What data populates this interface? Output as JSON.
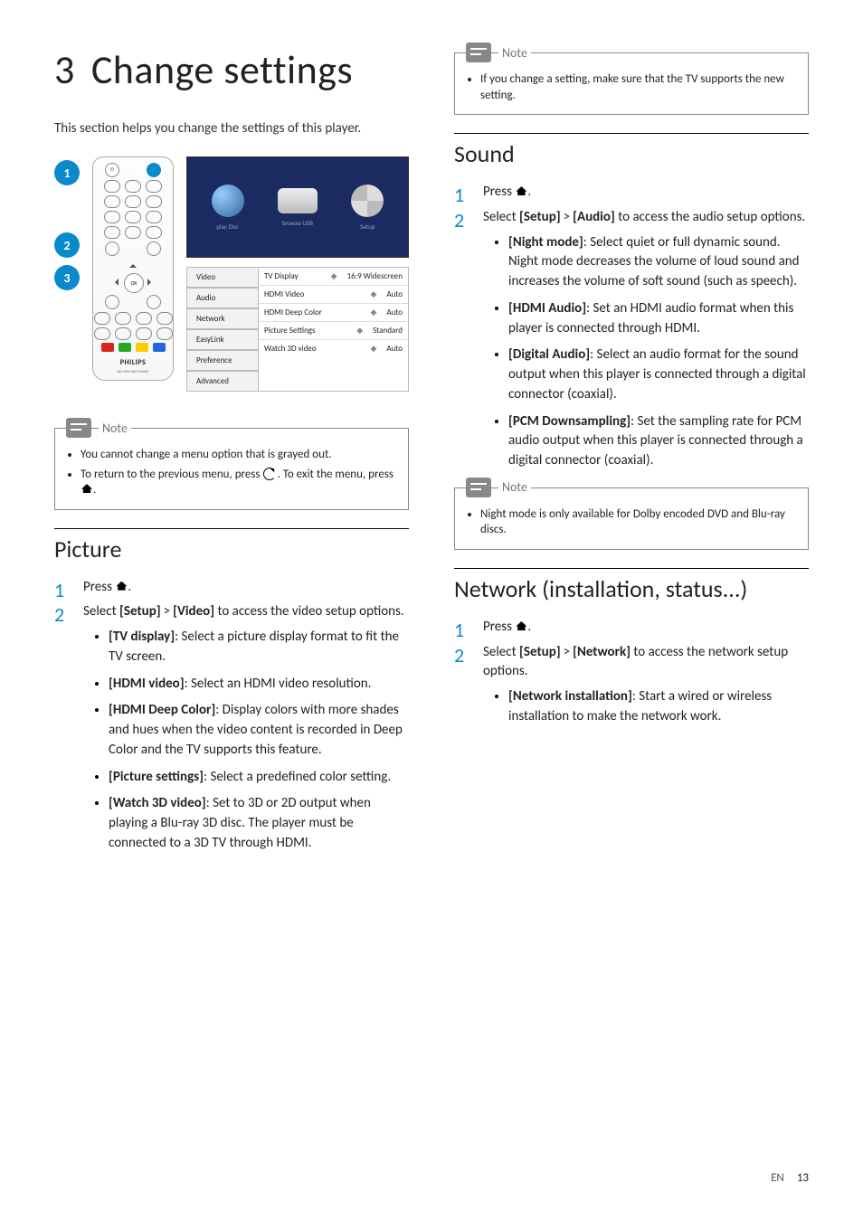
{
  "chapter": {
    "number": "3",
    "title": "Change settings"
  },
  "intro": "This section helps you change the settings of this player.",
  "illustration": {
    "badges": [
      "1",
      "2",
      "3"
    ],
    "remote": {
      "brand": "PHILIPS",
      "sub": "BLU-RAY DISC PLAYER",
      "ok": "OK"
    },
    "home_screen": [
      {
        "label": "play Disc"
      },
      {
        "label": "browse USB"
      },
      {
        "label": "Setup"
      }
    ],
    "sidebar": [
      "Video",
      "Audio",
      "Network",
      "EasyLink",
      "Preference",
      "Advanced"
    ],
    "options": [
      {
        "k": "TV Display",
        "v": "16:9 Widescreen"
      },
      {
        "k": "HDMI Video",
        "v": "Auto"
      },
      {
        "k": "HDMI Deep Color",
        "v": "Auto"
      },
      {
        "k": "Picture Settings",
        "v": "Standard"
      },
      {
        "k": "Watch 3D video",
        "v": "Auto"
      }
    ]
  },
  "note1": {
    "label": "Note",
    "items": [
      "You cannot change a menu option that is grayed out.",
      {
        "pre": "To return to the previous menu, press ",
        "mid": ". To exit the menu, press ",
        "post": "."
      }
    ]
  },
  "note_top_right": {
    "label": "Note",
    "items": [
      "If you change a setting, make sure that the TV supports the new setting."
    ]
  },
  "note_sound": {
    "label": "Note",
    "items": [
      "Night mode is only available for Dolby encoded DVD and Blu-ray discs."
    ]
  },
  "picture": {
    "heading": "Picture",
    "step1": "Press ",
    "step1_post": ".",
    "step2_pre": "Select ",
    "step2_a": "[Setup]",
    "step2_gt": ">",
    "step2_b": "[Video]",
    "step2_post": " to access the video setup options.",
    "bullets": [
      {
        "b": "[TV display]",
        "t": ": Select a picture display format to fit the TV screen."
      },
      {
        "b": "[HDMI video]",
        "t": ": Select an HDMI video resolution."
      },
      {
        "b": "[HDMI Deep Color]",
        "t": ": Display colors with more shades and hues when the video content is recorded in Deep Color and the TV supports this feature."
      },
      {
        "b": "[Picture settings]",
        "t": ": Select a predefined color setting."
      },
      {
        "b": "[Watch 3D video]",
        "t": ": Set to 3D or 2D output when playing a Blu-ray 3D disc. The player must be connected to a 3D TV through HDMI."
      }
    ]
  },
  "sound": {
    "heading": "Sound",
    "step1": "Press ",
    "step1_post": ".",
    "step2_pre": "Select ",
    "step2_a": "[Setup]",
    "step2_gt": ">",
    "step2_b": "[Audio]",
    "step2_post": " to access the audio setup options.",
    "bullets": [
      {
        "b": "[Night mode]",
        "t": ": Select quiet or full dynamic sound. Night mode decreases the volume of loud sound and increases the volume of soft sound (such as speech)."
      },
      {
        "b": "[HDMI Audio]",
        "t": ": Set an HDMI audio format when this player is connected through HDMI."
      },
      {
        "b": "[Digital Audio]",
        "t": ": Select an audio format for the sound output when this player is connected through a digital connector (coaxial)."
      },
      {
        "b": "[PCM Downsampling]",
        "t": ": Set the sampling rate for PCM audio output when this player is connected through a digital connector (coaxial)."
      }
    ]
  },
  "network": {
    "heading": "Network (installation, status...)",
    "step1": "Press ",
    "step1_post": ".",
    "step2_pre": "Select ",
    "step2_a": "[Setup]",
    "step2_gt": ">",
    "step2_b": "[Network]",
    "step2_post": " to access the network setup options.",
    "bullets": [
      {
        "b": "[Network installation]",
        "t": ": Start a wired or wireless installation to make the network work."
      }
    ]
  },
  "footer": {
    "lang": "EN",
    "page": "13"
  }
}
